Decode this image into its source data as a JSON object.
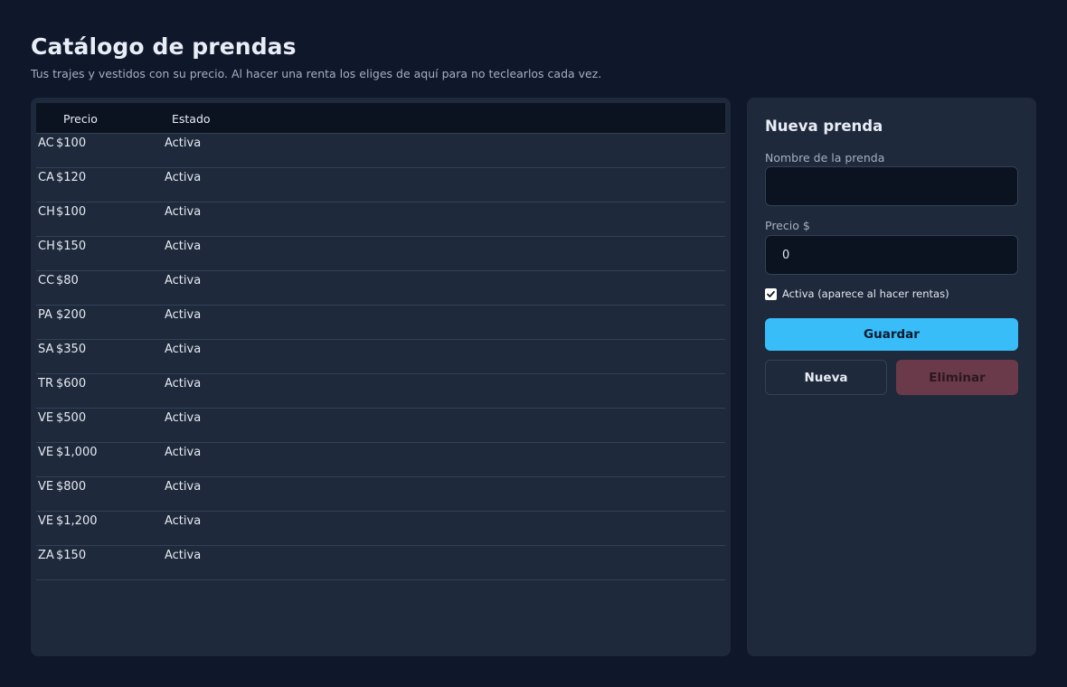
{
  "header": {
    "title": "Catálogo de prendas",
    "subtitle": "Tus trajes y vestidos con su precio. Al hacer una renta los eliges de aquí para no teclearlos cada vez."
  },
  "table": {
    "columns": [
      "Precio",
      "Estado"
    ],
    "rows": [
      {
        "name": "AC",
        "price": "$100",
        "status": "Activa"
      },
      {
        "name": "CA",
        "price": "$120",
        "status": "Activa"
      },
      {
        "name": "CH",
        "price": "$100",
        "status": "Activa"
      },
      {
        "name": "CH",
        "price": "$150",
        "status": "Activa"
      },
      {
        "name": "CC",
        "price": "$80",
        "status": "Activa"
      },
      {
        "name": "PA",
        "price": "$200",
        "status": "Activa"
      },
      {
        "name": "SA",
        "price": "$350",
        "status": "Activa"
      },
      {
        "name": "TR",
        "price": "$600",
        "status": "Activa"
      },
      {
        "name": "VE",
        "price": "$500",
        "status": "Activa"
      },
      {
        "name": "VE",
        "price": "$1,000",
        "status": "Activa"
      },
      {
        "name": "VE",
        "price": "$800",
        "status": "Activa"
      },
      {
        "name": "VE",
        "price": "$1,200",
        "status": "Activa"
      },
      {
        "name": "ZA",
        "price": "$150",
        "status": "Activa"
      }
    ]
  },
  "form": {
    "title": "Nueva prenda",
    "name_label": "Nombre de la prenda",
    "name_value": "",
    "price_label": "Precio $",
    "price_value": "0",
    "active_label": "Activa (aparece al hacer rentas)",
    "active_checked": true,
    "save_label": "Guardar",
    "new_label": "Nueva",
    "delete_label": "Eliminar"
  },
  "colors": {
    "background": "#0f172a",
    "panel": "#1e293b",
    "accent": "#38bdf8",
    "danger": "#6b3a4a"
  },
  "icons": {
    "checkbox": "checkmark-icon"
  }
}
